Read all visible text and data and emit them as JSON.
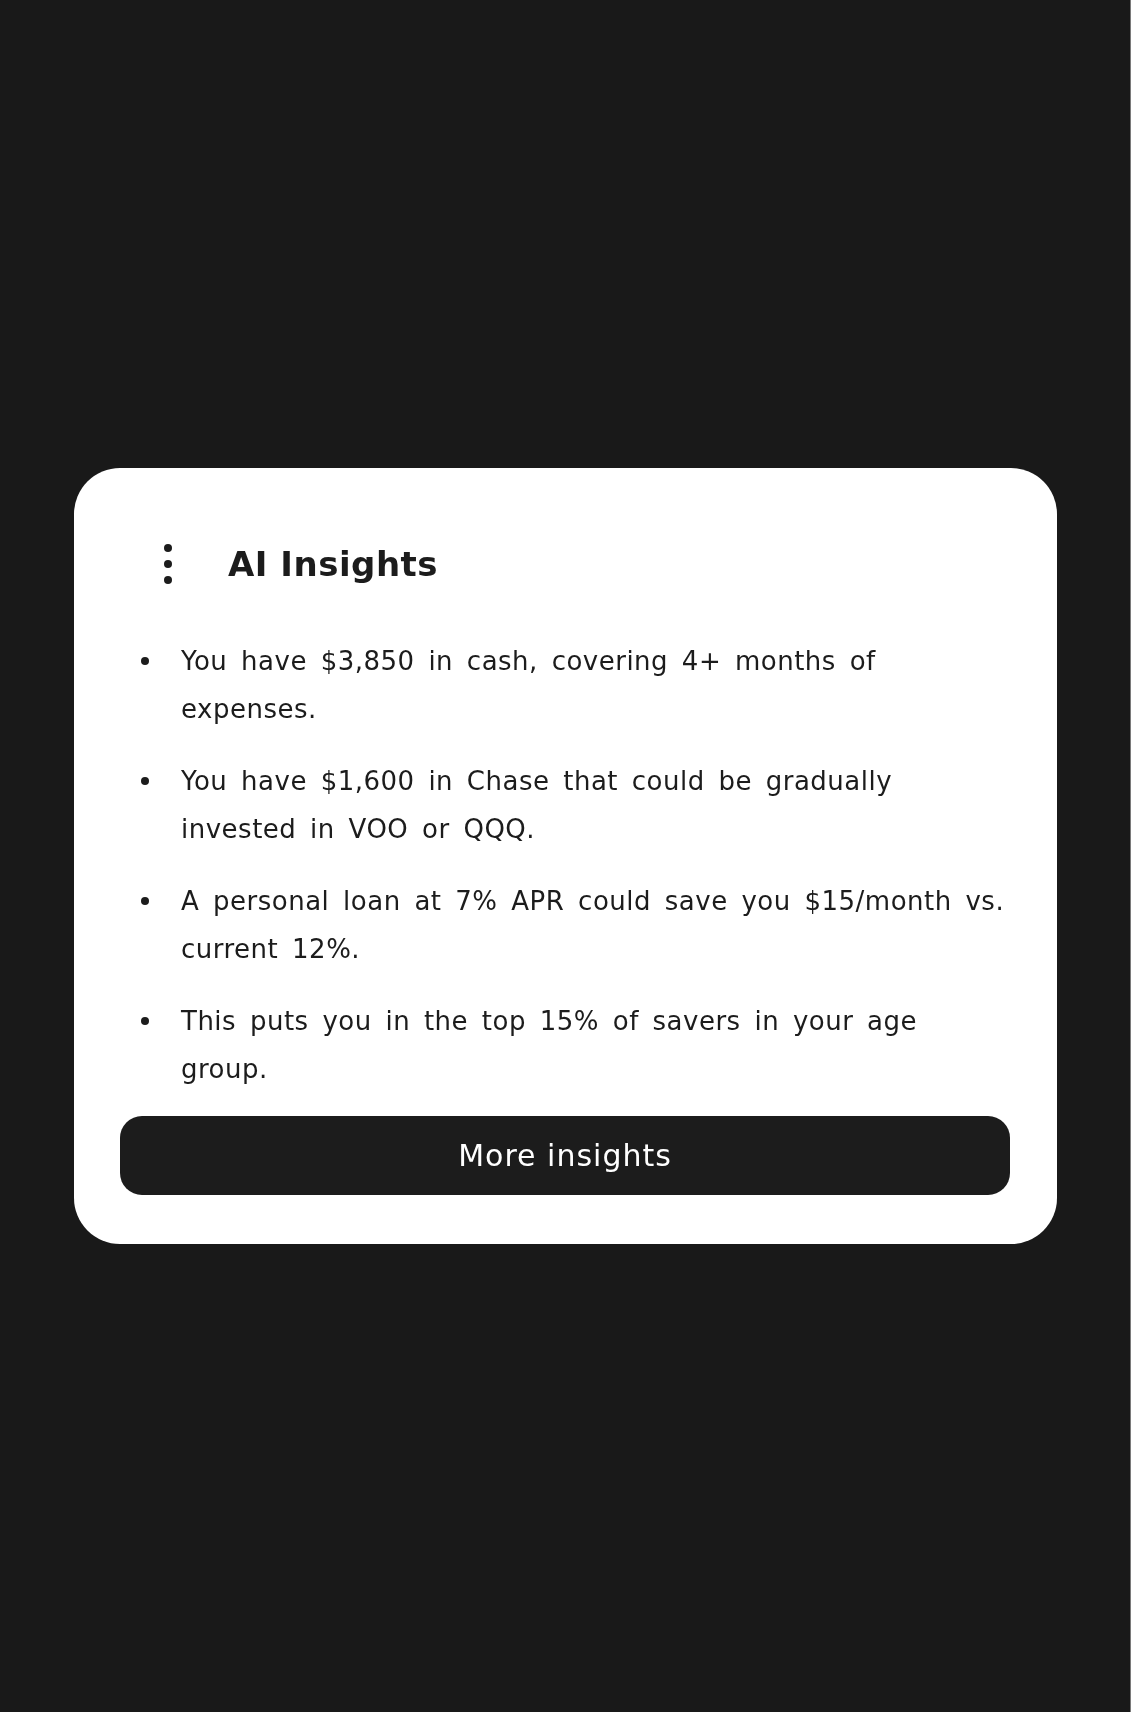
{
  "card": {
    "title": "AI Insights",
    "insights": [
      "You have $3,850 in cash, covering 4+ months of expenses.",
      "You have $1,600 in Chase that could be gradually invested in VOO or QQQ.",
      "A personal loan at 7% APR could save you $15/month vs. current 12%.",
      "This puts you in the top 15% of savers in your age group."
    ],
    "button": "More insights"
  }
}
